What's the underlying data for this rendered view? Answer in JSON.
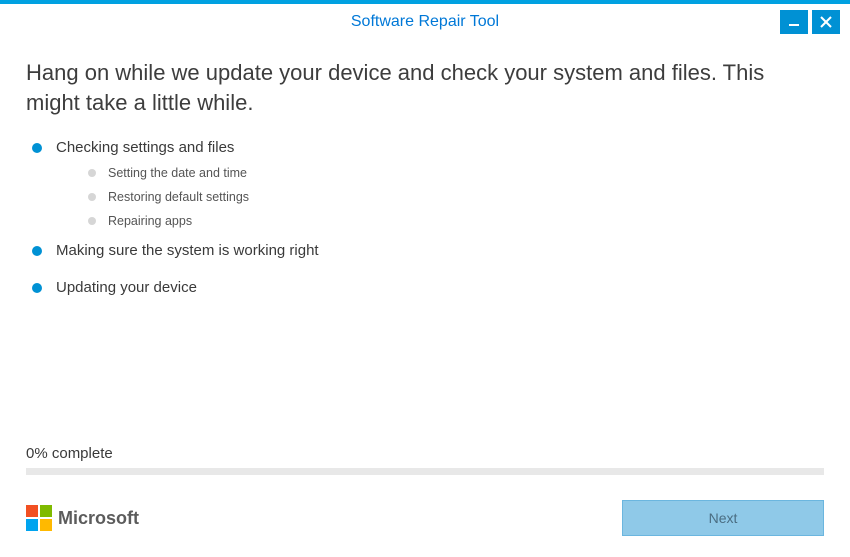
{
  "window": {
    "title": "Software Repair Tool"
  },
  "headline": "Hang on while we update your device and check your system and files. This might take a little while.",
  "steps": [
    {
      "label": "Checking settings and files",
      "substeps": [
        "Setting the date and time",
        "Restoring default settings",
        "Repairing apps"
      ]
    },
    {
      "label": "Making sure the system is working right"
    },
    {
      "label": "Updating your device"
    }
  ],
  "progress": {
    "label": "0% complete",
    "percent": 0
  },
  "footer": {
    "brand": "Microsoft",
    "next_label": "Next"
  }
}
